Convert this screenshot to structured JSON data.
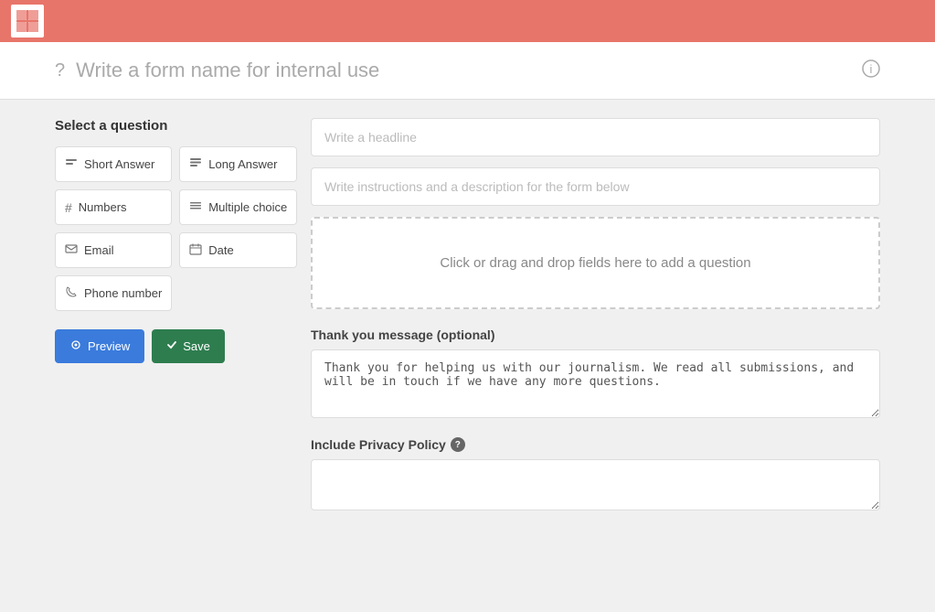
{
  "topbar": {
    "logo_text": "❖"
  },
  "form_title": {
    "placeholder": "Write a form name for internal use",
    "help_icon": "?",
    "info_icon": "ℹ"
  },
  "left_panel": {
    "heading": "Select a question",
    "buttons": [
      {
        "id": "short-answer",
        "icon": "☰",
        "label": "Short Answer"
      },
      {
        "id": "long-answer",
        "icon": "¶",
        "label": "Long Answer"
      },
      {
        "id": "numbers",
        "icon": "#",
        "label": "Numbers"
      },
      {
        "id": "multiple-choice",
        "icon": "≡",
        "label": "Multiple choice"
      },
      {
        "id": "email",
        "icon": "✉",
        "label": "Email"
      },
      {
        "id": "date",
        "icon": "📅",
        "label": "Date"
      },
      {
        "id": "phone-number",
        "icon": "📞",
        "label": "Phone number"
      }
    ],
    "preview_label": "Preview",
    "save_label": "Save"
  },
  "right_panel": {
    "headline_placeholder": "Write a headline",
    "description_placeholder": "Write instructions and a description for the form below",
    "drop_zone_text": "Click or drag and drop fields here to add a question",
    "thank_you_label": "Thank you message (optional)",
    "thank_you_value": "Thank you for helping us with our journalism. We read all submissions, and will be in touch if we have any more questions.",
    "privacy_label": "Include Privacy Policy",
    "privacy_value": ""
  }
}
